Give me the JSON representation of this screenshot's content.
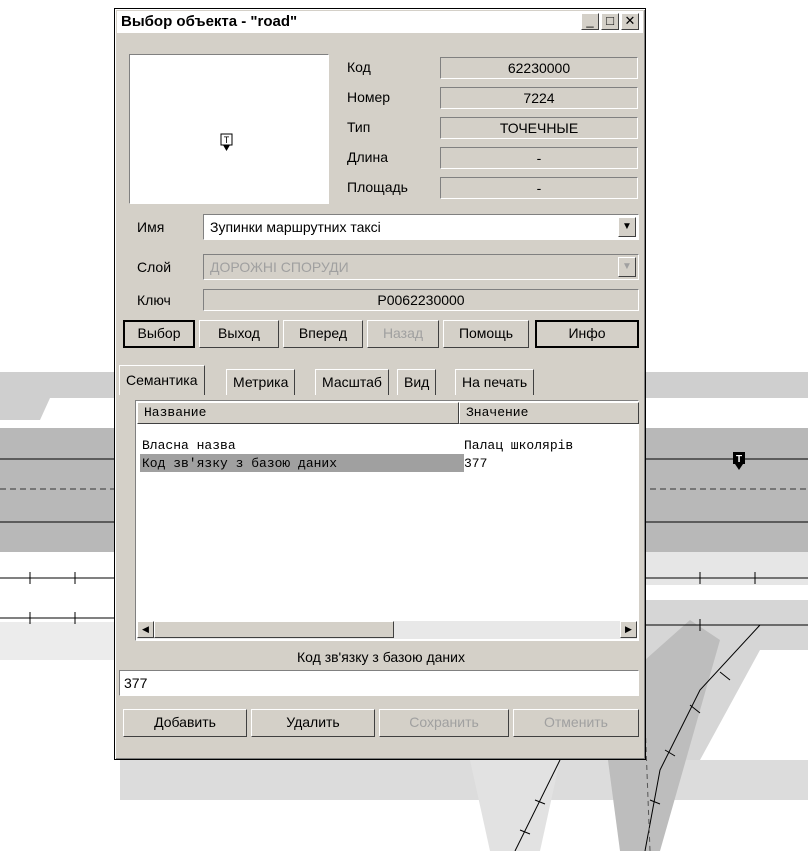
{
  "window": {
    "title": "Выбор объекта - \"road\""
  },
  "window_buttons": {
    "minimize": "_",
    "maximize": "□",
    "close": "✕"
  },
  "properties": [
    {
      "label": "Код",
      "value": "62230000"
    },
    {
      "label": "Номер",
      "value": "7224"
    },
    {
      "label": "Тип",
      "value": "ТОЧЕЧНЫЕ"
    },
    {
      "label": "Длина",
      "value": "-"
    },
    {
      "label": "Площадь",
      "value": "-"
    }
  ],
  "fields": {
    "name_label": "Имя",
    "name_value": "Зупинки маршрутних таксі",
    "layer_label": "Слой",
    "layer_value": "ДОРОЖНІ СПОРУДИ",
    "key_label": "Ключ",
    "key_value": "P0062230000"
  },
  "nav_buttons": {
    "select": "Выбор",
    "exit": "Выход",
    "forward": "Вперед",
    "back": "Назад",
    "help": "Помощь",
    "info": "Инфо"
  },
  "tabs": {
    "semantics": "Семантика",
    "metrics": "Метрика",
    "scale": "Масштаб",
    "view": "Вид",
    "print": "На печать"
  },
  "table": {
    "headers": [
      "Название",
      "Значение"
    ],
    "rows": [
      {
        "name": "Власна назва",
        "value": "Палац школярів"
      },
      {
        "name": "Код зв'язку з базою даних",
        "value": "377"
      }
    ]
  },
  "editor": {
    "label": "Код зв'язку з базою даних",
    "value": "377"
  },
  "action_buttons": {
    "add": "Добавить",
    "delete": "Удалить",
    "save": "Сохранить",
    "cancel": "Отменить"
  },
  "icons": {
    "map_marker": "T",
    "scroll_left": "◀",
    "scroll_right": "▶",
    "combo_arrow": "▼"
  },
  "colors": {
    "map_road": "#c8c8c8",
    "map_dark": "#a0a0a0",
    "dialog_face": "#d4d0c8",
    "selection": "#a0a0a0"
  }
}
